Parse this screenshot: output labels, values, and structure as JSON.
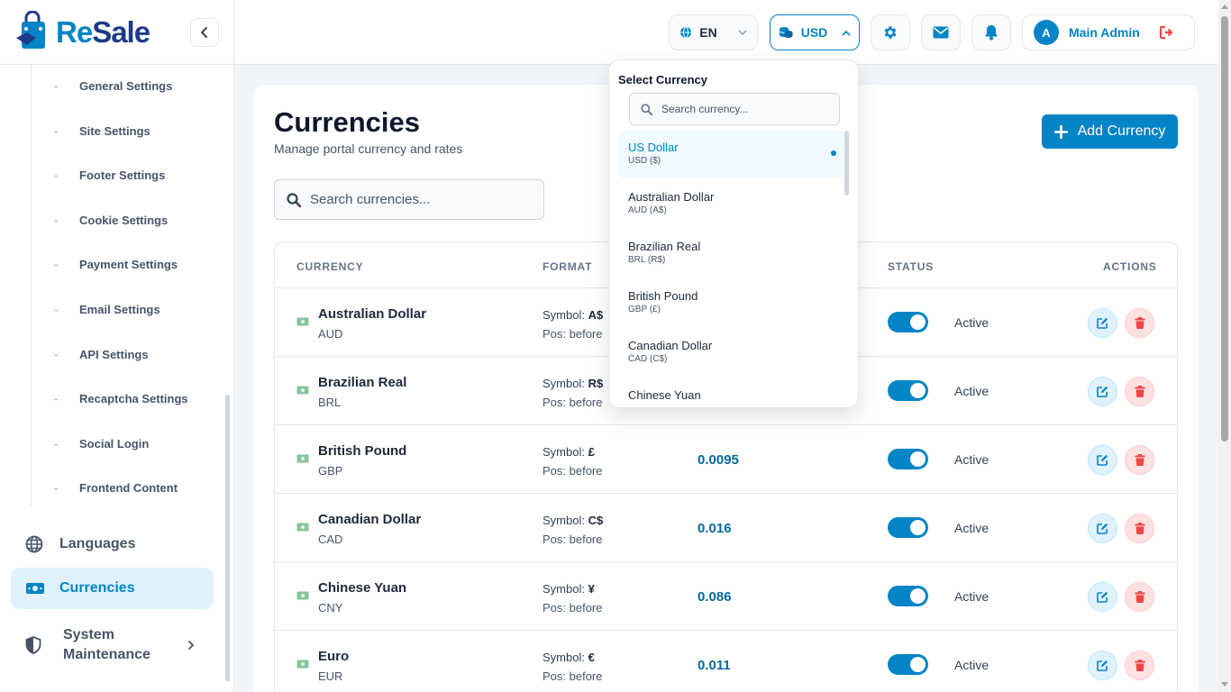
{
  "brand": {
    "logo_re": "Re",
    "logo_sale": "Sale"
  },
  "sidebar": {
    "sub_items": [
      {
        "label": "General Settings"
      },
      {
        "label": "Site Settings"
      },
      {
        "label": "Footer Settings"
      },
      {
        "label": "Cookie Settings"
      },
      {
        "label": "Payment Settings"
      },
      {
        "label": "Email Settings"
      },
      {
        "label": "API Settings"
      },
      {
        "label": "Recaptcha Settings"
      },
      {
        "label": "Social Login"
      },
      {
        "label": "Frontend Content"
      }
    ],
    "sub_dash": "-",
    "nav": {
      "languages": "Languages",
      "currencies": "Currencies",
      "system_maintenance_1": "System",
      "system_maintenance_2": "Maintenance"
    }
  },
  "topbar": {
    "language": "EN",
    "currency": "USD",
    "user_initial": "A",
    "user_name": "Main Admin"
  },
  "page": {
    "title": "Currencies",
    "subtitle": "Manage portal currency and rates",
    "add_button": "Add Currency",
    "search_placeholder": "Search currencies..."
  },
  "table": {
    "headers": {
      "currency": "CURRENCY",
      "format": "FORMAT",
      "status": "STATUS",
      "actions": "ACTIONS"
    },
    "symbol_label": "Symbol: ",
    "rows": [
      {
        "name": "Australian Dollar",
        "code": "AUD",
        "symbol": "A$",
        "position": "Pos: before",
        "rate": "",
        "status": "Active"
      },
      {
        "name": "Brazilian Real",
        "code": "BRL",
        "symbol": "R$",
        "position": "Pos: before",
        "rate": "",
        "status": "Active"
      },
      {
        "name": "British Pound",
        "code": "GBP",
        "symbol": "£",
        "position": "Pos: before",
        "rate": "0.0095",
        "status": "Active"
      },
      {
        "name": "Canadian Dollar",
        "code": "CAD",
        "symbol": "C$",
        "position": "Pos: before",
        "rate": "0.016",
        "status": "Active"
      },
      {
        "name": "Chinese Yuan",
        "code": "CNY",
        "symbol": "¥",
        "position": "Pos: before",
        "rate": "0.086",
        "status": "Active"
      },
      {
        "name": "Euro",
        "code": "EUR",
        "symbol": "€",
        "position": "Pos: before",
        "rate": "0.011",
        "status": "Active"
      }
    ]
  },
  "dropdown": {
    "title": "Select Currency",
    "search_placeholder": "Search currency...",
    "options": [
      {
        "name": "US Dollar",
        "code": "USD ($)"
      },
      {
        "name": "Australian Dollar",
        "code": "AUD (A$)"
      },
      {
        "name": "Brazilian Real",
        "code": "BRL (R$)"
      },
      {
        "name": "British Pound",
        "code": "GBP (£)"
      },
      {
        "name": "Canadian Dollar",
        "code": "CAD (C$)"
      },
      {
        "name": "Chinese Yuan",
        "code": ""
      }
    ]
  },
  "colors": {
    "accent": "#0284c7",
    "danger": "#ef4444",
    "active_bg": "#e0f2fe"
  }
}
